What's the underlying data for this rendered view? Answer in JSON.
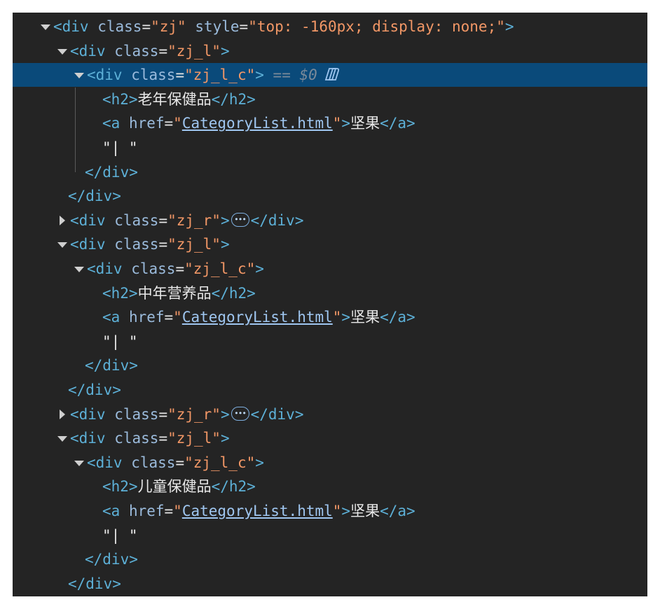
{
  "lines": [
    {
      "toggle": "open",
      "parts": [
        {
          "c": "tag",
          "t": "<div "
        },
        {
          "c": "attr",
          "t": "class"
        },
        {
          "c": "txt",
          "t": "="
        },
        {
          "c": "val",
          "t": "\"zj\""
        },
        {
          "c": "txt",
          "t": " "
        },
        {
          "c": "attr",
          "t": "style"
        },
        {
          "c": "txt",
          "t": "="
        },
        {
          "c": "val",
          "t": "\"top: -160px; display: none;\""
        },
        {
          "c": "tag",
          "t": ">"
        }
      ]
    },
    {
      "toggle": "open",
      "parts": [
        {
          "c": "tag",
          "t": "<div "
        },
        {
          "c": "attr",
          "t": "class"
        },
        {
          "c": "txt",
          "t": "="
        },
        {
          "c": "val",
          "t": "\"zj_l\""
        },
        {
          "c": "tag",
          "t": ">"
        }
      ]
    },
    {
      "toggle": "open",
      "selected": true,
      "parts": [
        {
          "c": "tag",
          "t": "<div "
        },
        {
          "c": "attr",
          "t": "class"
        },
        {
          "c": "txt",
          "t": "="
        },
        {
          "c": "val",
          "t": "\"zj_l_c\""
        },
        {
          "c": "tag",
          "t": ">"
        },
        {
          "c": "dollar",
          "t": " == $0"
        },
        {
          "c": "copilot",
          "icon": "copilot-icon"
        }
      ]
    },
    {
      "toggle": "none",
      "parts": [
        {
          "c": "tag",
          "t": "<h2>"
        },
        {
          "c": "txt",
          "t": "老年保健品"
        },
        {
          "c": "tag",
          "t": "</h2>"
        }
      ]
    },
    {
      "toggle": "none",
      "parts": [
        {
          "c": "tag",
          "t": "<a "
        },
        {
          "c": "attr",
          "t": "href"
        },
        {
          "c": "txt",
          "t": "="
        },
        {
          "c": "val",
          "t": "\""
        },
        {
          "c": "link",
          "t": "CategoryList.html"
        },
        {
          "c": "val",
          "t": "\""
        },
        {
          "c": "tag",
          "t": ">"
        },
        {
          "c": "txt",
          "t": "坚果"
        },
        {
          "c": "tag",
          "t": "</a>"
        }
      ]
    },
    {
      "toggle": "none",
      "parts": [
        {
          "c": "txt",
          "t": "\"| \""
        }
      ]
    },
    {
      "toggle": "none",
      "parts": [
        {
          "c": "tag",
          "t": "</div>"
        }
      ]
    },
    {
      "toggle": "none",
      "parts": [
        {
          "c": "tag",
          "t": "</div>"
        }
      ]
    },
    {
      "toggle": "closed",
      "parts": [
        {
          "c": "tag",
          "t": "<div "
        },
        {
          "c": "attr",
          "t": "class"
        },
        {
          "c": "txt",
          "t": "="
        },
        {
          "c": "val",
          "t": "\"zj_r\""
        },
        {
          "c": "tag",
          "t": ">"
        },
        {
          "c": "ell",
          "icon": "ellipsis-icon"
        },
        {
          "c": "tag",
          "t": "</div>"
        }
      ]
    },
    {
      "toggle": "open",
      "parts": [
        {
          "c": "tag",
          "t": "<div "
        },
        {
          "c": "attr",
          "t": "class"
        },
        {
          "c": "txt",
          "t": "="
        },
        {
          "c": "val",
          "t": "\"zj_l\""
        },
        {
          "c": "tag",
          "t": ">"
        }
      ]
    },
    {
      "toggle": "open",
      "parts": [
        {
          "c": "tag",
          "t": "<div "
        },
        {
          "c": "attr",
          "t": "class"
        },
        {
          "c": "txt",
          "t": "="
        },
        {
          "c": "val",
          "t": "\"zj_l_c\""
        },
        {
          "c": "tag",
          "t": ">"
        }
      ]
    },
    {
      "toggle": "none",
      "parts": [
        {
          "c": "tag",
          "t": "<h2>"
        },
        {
          "c": "txt",
          "t": "中年营养品"
        },
        {
          "c": "tag",
          "t": "</h2>"
        }
      ]
    },
    {
      "toggle": "none",
      "parts": [
        {
          "c": "tag",
          "t": "<a "
        },
        {
          "c": "attr",
          "t": "href"
        },
        {
          "c": "txt",
          "t": "="
        },
        {
          "c": "val",
          "t": "\""
        },
        {
          "c": "link",
          "t": "CategoryList.html"
        },
        {
          "c": "val",
          "t": "\""
        },
        {
          "c": "tag",
          "t": ">"
        },
        {
          "c": "txt",
          "t": "坚果"
        },
        {
          "c": "tag",
          "t": "</a>"
        }
      ]
    },
    {
      "toggle": "none",
      "parts": [
        {
          "c": "txt",
          "t": "\"| \""
        }
      ]
    },
    {
      "toggle": "none",
      "parts": [
        {
          "c": "tag",
          "t": "</div>"
        }
      ]
    },
    {
      "toggle": "none",
      "parts": [
        {
          "c": "tag",
          "t": "</div>"
        }
      ]
    },
    {
      "toggle": "closed",
      "parts": [
        {
          "c": "tag",
          "t": "<div "
        },
        {
          "c": "attr",
          "t": "class"
        },
        {
          "c": "txt",
          "t": "="
        },
        {
          "c": "val",
          "t": "\"zj_r\""
        },
        {
          "c": "tag",
          "t": ">"
        },
        {
          "c": "ell",
          "icon": "ellipsis-icon"
        },
        {
          "c": "tag",
          "t": "</div>"
        }
      ]
    },
    {
      "toggle": "open",
      "parts": [
        {
          "c": "tag",
          "t": "<div "
        },
        {
          "c": "attr",
          "t": "class"
        },
        {
          "c": "txt",
          "t": "="
        },
        {
          "c": "val",
          "t": "\"zj_l\""
        },
        {
          "c": "tag",
          "t": ">"
        }
      ]
    },
    {
      "toggle": "open",
      "parts": [
        {
          "c": "tag",
          "t": "<div "
        },
        {
          "c": "attr",
          "t": "class"
        },
        {
          "c": "txt",
          "t": "="
        },
        {
          "c": "val",
          "t": "\"zj_l_c\""
        },
        {
          "c": "tag",
          "t": ">"
        }
      ]
    },
    {
      "toggle": "none",
      "parts": [
        {
          "c": "tag",
          "t": "<h2>"
        },
        {
          "c": "txt",
          "t": "儿童保健品"
        },
        {
          "c": "tag",
          "t": "</h2>"
        }
      ]
    },
    {
      "toggle": "none",
      "parts": [
        {
          "c": "tag",
          "t": "<a "
        },
        {
          "c": "attr",
          "t": "href"
        },
        {
          "c": "txt",
          "t": "="
        },
        {
          "c": "val",
          "t": "\""
        },
        {
          "c": "link",
          "t": "CategoryList.html"
        },
        {
          "c": "val",
          "t": "\""
        },
        {
          "c": "tag",
          "t": ">"
        },
        {
          "c": "txt",
          "t": "坚果"
        },
        {
          "c": "tag",
          "t": "</a>"
        }
      ]
    },
    {
      "toggle": "none",
      "parts": [
        {
          "c": "txt",
          "t": "\"| \""
        }
      ]
    },
    {
      "toggle": "none",
      "parts": [
        {
          "c": "tag",
          "t": "</div>"
        }
      ]
    },
    {
      "toggle": "none",
      "parts": [
        {
          "c": "tag",
          "t": "</div>"
        }
      ]
    }
  ]
}
